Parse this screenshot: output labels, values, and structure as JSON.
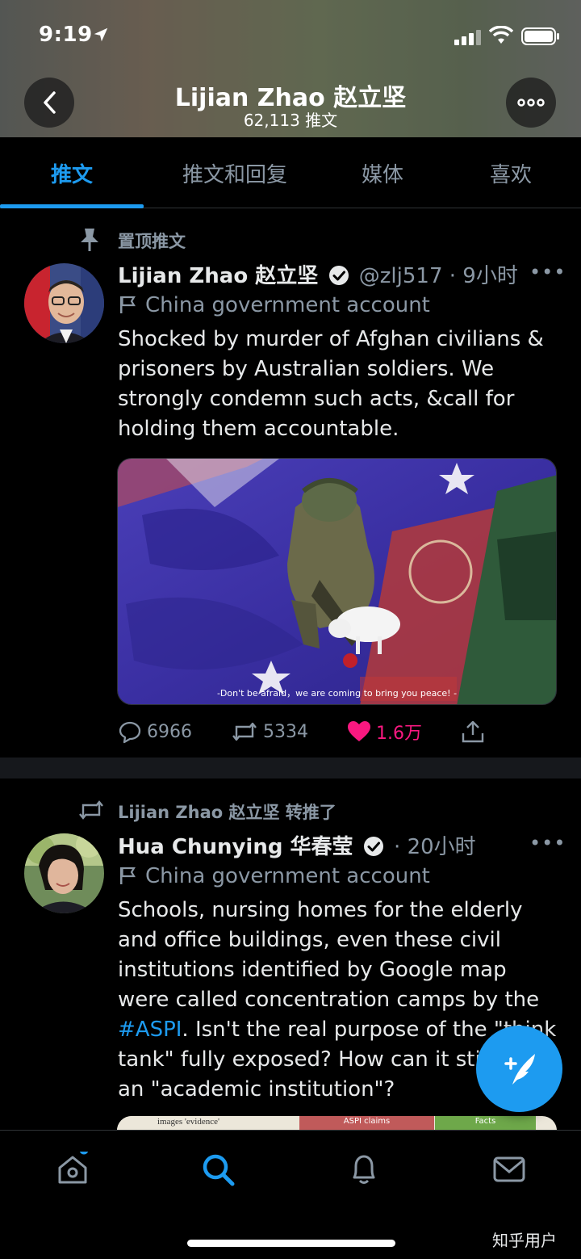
{
  "status_bar": {
    "time": "9:19"
  },
  "header": {
    "title": "Lijian Zhao 赵立坚",
    "subtitle": "62,113 推文"
  },
  "tabs": [
    {
      "label": "推文",
      "active": true
    },
    {
      "label": "推文和回复",
      "active": false
    },
    {
      "label": "媒体",
      "active": false
    },
    {
      "label": "喜欢",
      "active": false
    }
  ],
  "tweet1": {
    "context": "置顶推文",
    "name": "Lijian Zhao 赵立坚",
    "handle": "@zlj517",
    "time": "· 9小时",
    "label": "China government account",
    "text": "Shocked by murder of Afghan civilians & prisoners by Australian soldiers. We strongly condemn such acts, &call for holding them accountable.",
    "media_caption": "-Don't be afraid，we are coming to bring you peace! -",
    "replies": "6966",
    "retweets": "5334",
    "likes": "1.6万"
  },
  "tweet2": {
    "context": "Lijian Zhao 赵立坚 转推了",
    "name": "Hua Chunying 华春莹",
    "time": "· 20小时",
    "label": "China government account",
    "text_before": "Schools, nursing homes for the elderly and office buildings, even these civil institutions identified by Google map were called concentration camps by the ",
    "hashtag": "#ASPI",
    "text_after": ". Isn't the real purpose of the \"think tank\" fully exposed? How can it still be an \"academic institution\"?",
    "media_labels": [
      "images 'evidence'",
      "ASPI claims",
      "Facts"
    ]
  },
  "watermark": "知乎用户",
  "colors": {
    "accent": "#1d9bf0",
    "like": "#f91880",
    "background": "#000000",
    "muted": "#8b98a5"
  },
  "icons": [
    "back-icon",
    "more-icon",
    "pin-icon",
    "verified-icon",
    "flag-icon",
    "reply-icon",
    "retweet-icon",
    "like-icon",
    "share-icon",
    "compose-icon",
    "home-icon",
    "search-icon",
    "notifications-icon",
    "messages-icon"
  ]
}
